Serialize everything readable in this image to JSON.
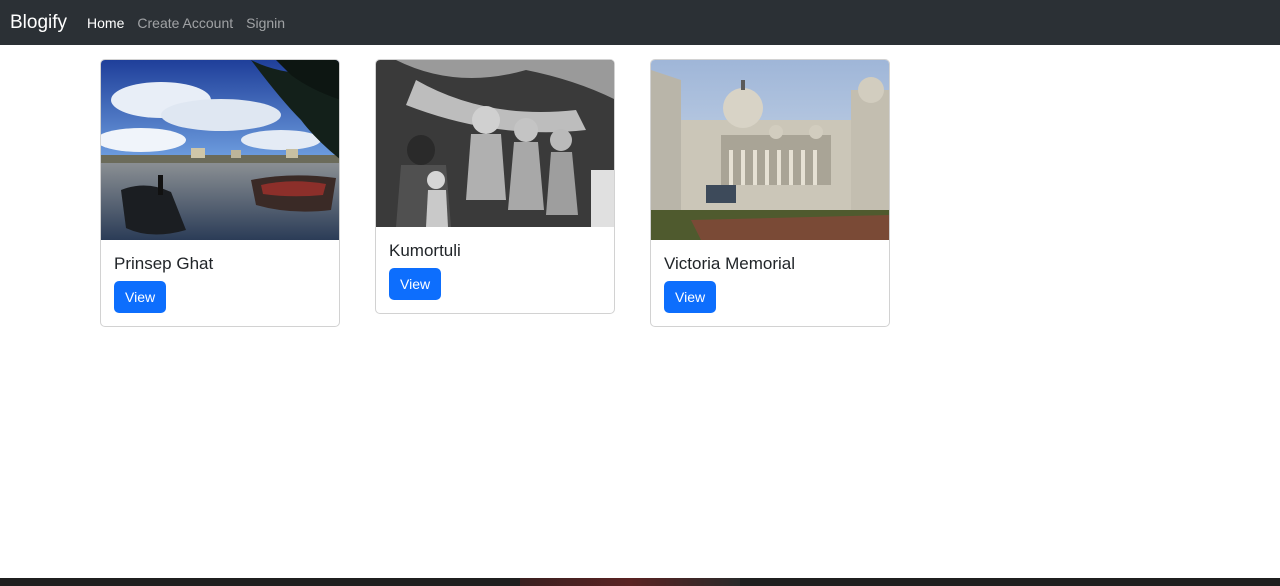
{
  "navbar": {
    "brand": "Blogify",
    "links": [
      {
        "label": "Home",
        "active": true
      },
      {
        "label": "Create Account",
        "active": false
      },
      {
        "label": "Signin",
        "active": false
      }
    ]
  },
  "cards": [
    {
      "title": "Prinsep Ghat",
      "button_label": "View"
    },
    {
      "title": "Kumortuli",
      "button_label": "View"
    },
    {
      "title": "Victoria Memorial",
      "button_label": "View"
    }
  ],
  "colors": {
    "navbar_bg": "#2b3035",
    "primary": "#0d6efd"
  }
}
